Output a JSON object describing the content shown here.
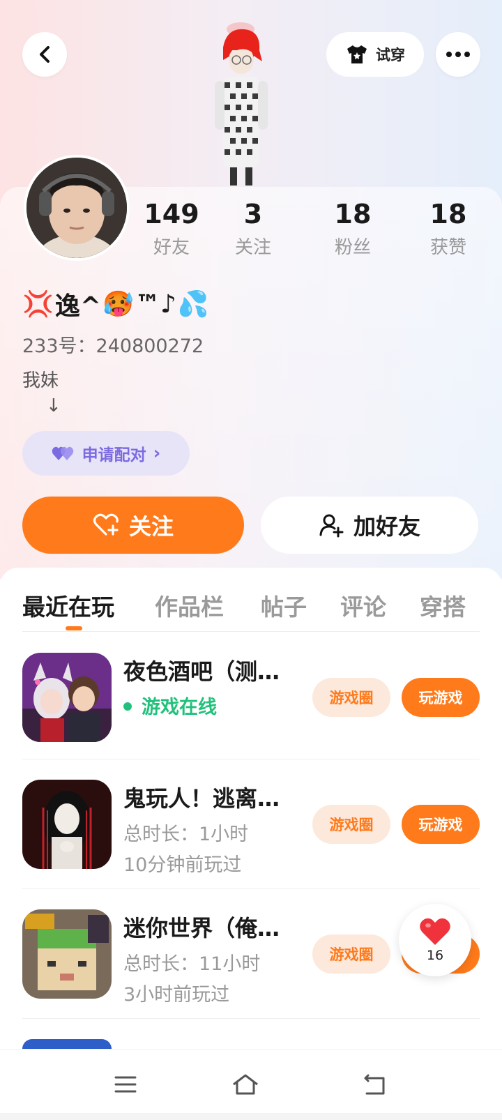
{
  "header": {
    "try_on_label": "试穿"
  },
  "profile": {
    "nickname": {
      "prefix_emoji": "💢",
      "text_a": "逸^",
      "mid_emoji": "🥵",
      "text_b": "™♪",
      "suffix_emoji": "💦"
    },
    "uid": "233号：240800272",
    "bio_line1": "我妹",
    "bio_line2": "↓",
    "pair_label": "申请配对",
    "pair_chevron": "›"
  },
  "stats": [
    {
      "value": "149",
      "label": "好友"
    },
    {
      "value": "3",
      "label": "关注"
    },
    {
      "value": "18",
      "label": "粉丝"
    },
    {
      "value": "18",
      "label": "获赞"
    }
  ],
  "actions": {
    "follow_label": "关注",
    "add_friend_label": "加好友"
  },
  "tabs": [
    {
      "label": "最近在玩",
      "active": true
    },
    {
      "label": "作品栏",
      "active": false
    },
    {
      "label": "帖子",
      "active": false
    },
    {
      "label": "评论",
      "active": false
    },
    {
      "label": "穿搭",
      "active": false
    }
  ],
  "games": [
    {
      "title": "夜色酒吧（测…",
      "sub1": "游戏在线",
      "sub2": "",
      "circle_label": "游戏圈",
      "play_label": "玩游戏"
    },
    {
      "title": "鬼玩人！逃离…",
      "sub1": "总时长：1小时",
      "sub2": "10分钟前玩过",
      "circle_label": "游戏圈",
      "play_label": "玩游戏"
    },
    {
      "title": "迷你世界（俺…",
      "sub1": "总时长：11小时",
      "sub2": "3小时前玩过",
      "circle_label": "游戏圈",
      "play_label": ""
    }
  ],
  "like_float": {
    "count": "16"
  },
  "colors": {
    "accent": "#ff7a1a",
    "online": "#21c07b",
    "pair": "#7b6be2"
  },
  "icons": {
    "back": "chevron-left-icon",
    "more": "more-dots-icon",
    "try_on": "tshirt-icon",
    "pair": "hearts-icon",
    "follow": "heart-plus-icon",
    "add_friend": "person-add-icon",
    "like": "heart-icon",
    "nav_menu": "menu-icon",
    "nav_home": "home-icon",
    "nav_back": "back-icon"
  }
}
